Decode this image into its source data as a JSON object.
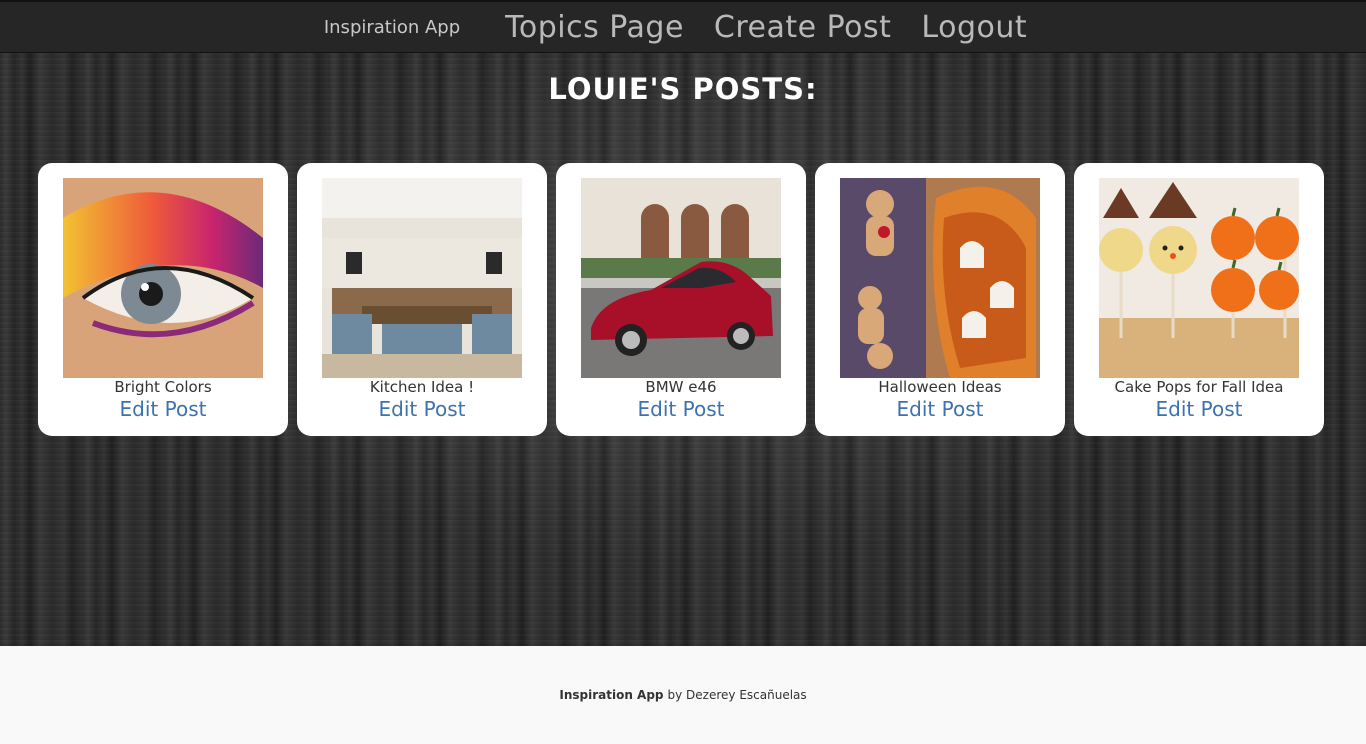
{
  "navbar": {
    "brand": "Inspiration App",
    "links": [
      "Topics Page",
      "Create Post",
      "Logout"
    ]
  },
  "page": {
    "heading": "LOUIE'S POSTS:"
  },
  "posts": [
    {
      "title": "Bright Colors",
      "edit_label": "Edit Post",
      "image": "eye-makeup-photo"
    },
    {
      "title": "Kitchen Idea !",
      "edit_label": "Edit Post",
      "image": "kitchen-photo"
    },
    {
      "title": "BMW e46",
      "edit_label": "Edit Post",
      "image": "red-car-photo"
    },
    {
      "title": "Halloween Ideas",
      "edit_label": "Edit Post",
      "image": "halloween-food-photo"
    },
    {
      "title": "Cake Pops for Fall Idea",
      "edit_label": "Edit Post",
      "image": "cake-pops-photo"
    }
  ],
  "footer": {
    "app_name": "Inspiration App",
    "credit": "by Dezerey Escañuelas"
  }
}
